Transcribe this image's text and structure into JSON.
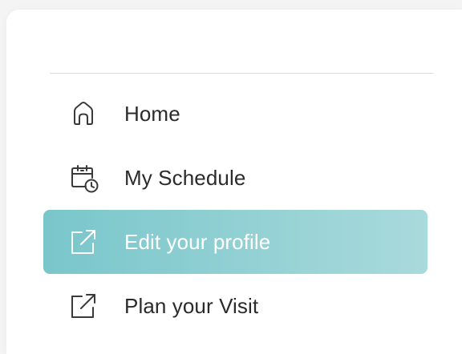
{
  "nav": {
    "items": [
      {
        "label": "Home",
        "icon": "home-icon",
        "active": false
      },
      {
        "label": "My Schedule",
        "icon": "calendar-clock-icon",
        "active": false
      },
      {
        "label": "Edit your profile",
        "icon": "external-link-icon",
        "active": true
      },
      {
        "label": "Plan your Visit",
        "icon": "external-link-icon",
        "active": false
      }
    ],
    "active_color_start": "#79c6cb",
    "active_color_end": "#a9dadc"
  }
}
